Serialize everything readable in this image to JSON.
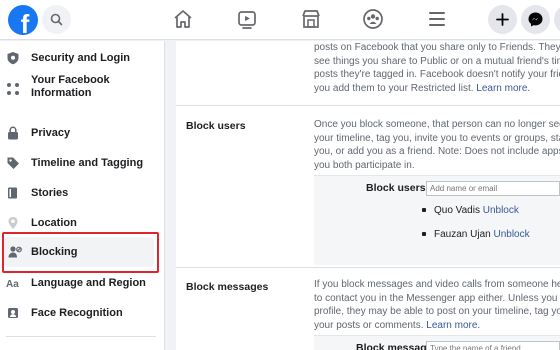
{
  "topbar": {
    "logo_letter": "f",
    "icons": [
      "search-icon",
      "home-icon",
      "watch-icon",
      "marketplace-icon",
      "groups-icon",
      "menu-icon",
      "plus-icon",
      "messenger-icon"
    ]
  },
  "sidebar": {
    "items": [
      {
        "label": "Security and Login",
        "icon": "shield-icon"
      },
      {
        "label": "Your Facebook Information",
        "icon": "grid-icon"
      },
      {
        "label": "Privacy",
        "icon": "lock-icon"
      },
      {
        "label": "Timeline and Tagging",
        "icon": "tag-icon"
      },
      {
        "label": "Stories",
        "icon": "book-icon"
      },
      {
        "label": "Location",
        "icon": "location-pin-icon"
      },
      {
        "label": "Blocking",
        "icon": "blocked-user-icon"
      },
      {
        "label": "Language and Region",
        "icon": "language-icon"
      },
      {
        "label": "Face Recognition",
        "icon": "face-icon"
      }
    ]
  },
  "restricted": {
    "line1": "posts on Facebook that you share only to Friends. They m",
    "line2": "see things you share to Public or on a mutual friend's time",
    "line3": "posts they're tagged in. Facebook doesn't notify your friend",
    "line4_prefix": "you add them to your Restricted list. ",
    "learn_more": "Learn more."
  },
  "block_users": {
    "title": "Block users",
    "desc_line1": "Once you block someone, that person can no longer see",
    "desc_line2": "your timeline, tag you, invite you to events or groups, start",
    "desc_line3": "you, or add you as a friend. Note: Does not include apps,",
    "desc_line4": "you both participate in.",
    "field_label": "Block users",
    "placeholder": "Add name or email",
    "blocked": [
      {
        "name": "Quo Vadis",
        "action": "Unblock"
      },
      {
        "name": "Fauzan Ujan",
        "action": "Unblock"
      }
    ]
  },
  "block_messages": {
    "title": "Block messages",
    "desc_line1": "If you block messages and video calls from someone her",
    "desc_line2": "to contact you in the Messenger app either. Unless you bl",
    "desc_line3": "profile, they may be able to post on your timeline, tag you,",
    "desc_line4_prefix": "your posts or comments. ",
    "learn_more": "Learn more.",
    "field_label": "Block messages",
    "placeholder": "Type the name of a friend..."
  },
  "colors": {
    "brand": "#1877f2",
    "link": "#365899",
    "highlight": "#e0242f"
  }
}
